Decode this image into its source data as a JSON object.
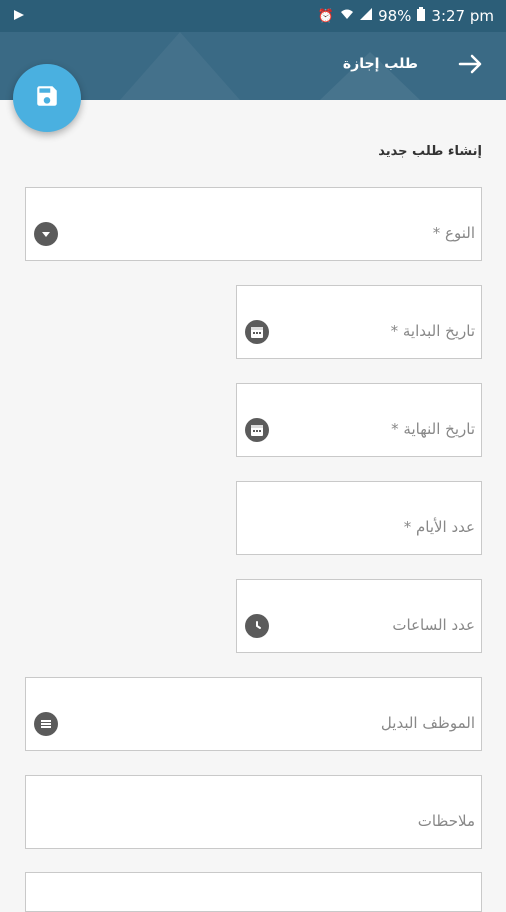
{
  "status_bar": {
    "battery": "98%",
    "time": "3:27 pm"
  },
  "app_bar": {
    "title": "طلب إجازة"
  },
  "form": {
    "heading": "إنشاء طلب جديد",
    "fields": {
      "type": {
        "label": "النوع *"
      },
      "start_date": {
        "label": "تاريخ البداية *"
      },
      "end_date": {
        "label": "تاريخ النهاية *"
      },
      "days_count": {
        "label": "عدد الأيام *"
      },
      "hours_count": {
        "label": "عدد الساعات"
      },
      "substitute_employee": {
        "label": "الموظف البديل"
      },
      "notes": {
        "label": "ملاحظات"
      }
    }
  },
  "colors": {
    "app_bar": "#3a6a85",
    "status_bar": "#2c5e78",
    "fab": "#4ab0e0",
    "icon": "#5b5b5b"
  }
}
